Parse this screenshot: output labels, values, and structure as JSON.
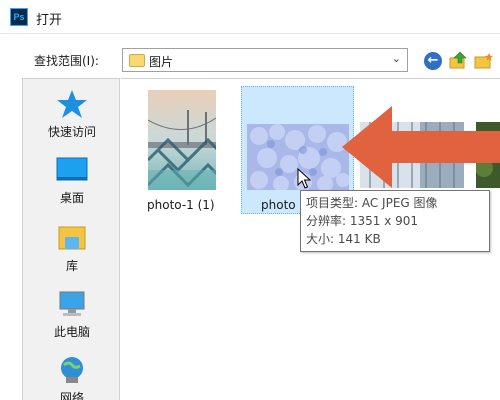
{
  "window": {
    "app_badge": "Ps",
    "title": "打开"
  },
  "lookin": {
    "label": "查找范围(I):",
    "current": "图片"
  },
  "places": [
    {
      "label": "快速访问",
      "icon": "star-icon"
    },
    {
      "label": "桌面",
      "icon": "desktop-icon"
    },
    {
      "label": "库",
      "icon": "library-icon"
    },
    {
      "label": "此电脑",
      "icon": "computer-icon"
    },
    {
      "label": "网络",
      "icon": "network-icon"
    }
  ],
  "files": [
    {
      "name": "photo-1 (1)",
      "thumb": "bridge-photo"
    },
    {
      "name": "photo",
      "thumb": "hydrangea-photo"
    }
  ],
  "tooltip": {
    "type_line": "项目类型: AC    JPEG 图像",
    "dims_line": "分辨率: 1351 x 901",
    "size_line": "大小: 141 KB"
  },
  "colors": {
    "accent_arrow": "#e0623f",
    "selection": "#cce8ff"
  }
}
